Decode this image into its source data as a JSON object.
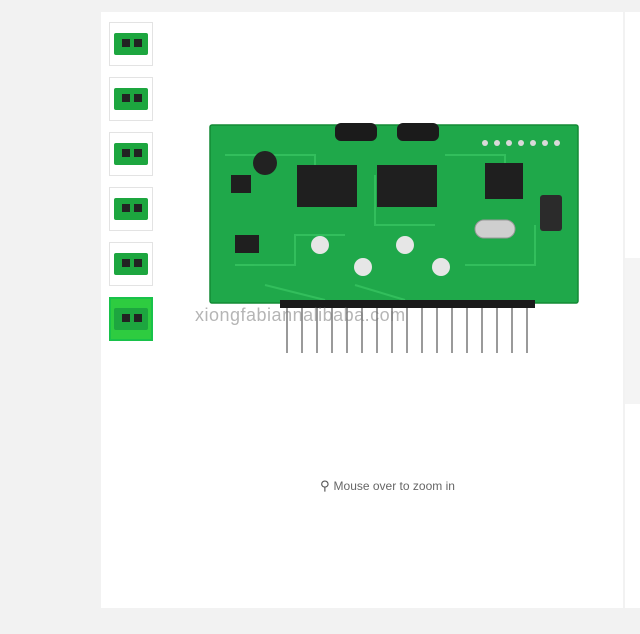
{
  "thumbnails": [
    {
      "name": "thumb-1",
      "active": false
    },
    {
      "name": "thumb-2",
      "active": false
    },
    {
      "name": "thumb-3",
      "active": false
    },
    {
      "name": "thumb-4",
      "active": false
    },
    {
      "name": "thumb-5",
      "active": false
    },
    {
      "name": "thumb-6",
      "active": true
    }
  ],
  "main_image": {
    "watermark": "xiongfabiannalibaba.com",
    "board_colors": {
      "pcb": "#1fa84a",
      "chip": "#1f1f1f",
      "pins": "#9a9a9a"
    }
  },
  "zoom": {
    "icon": "search-icon",
    "label": "Mouse over to zoom in"
  }
}
